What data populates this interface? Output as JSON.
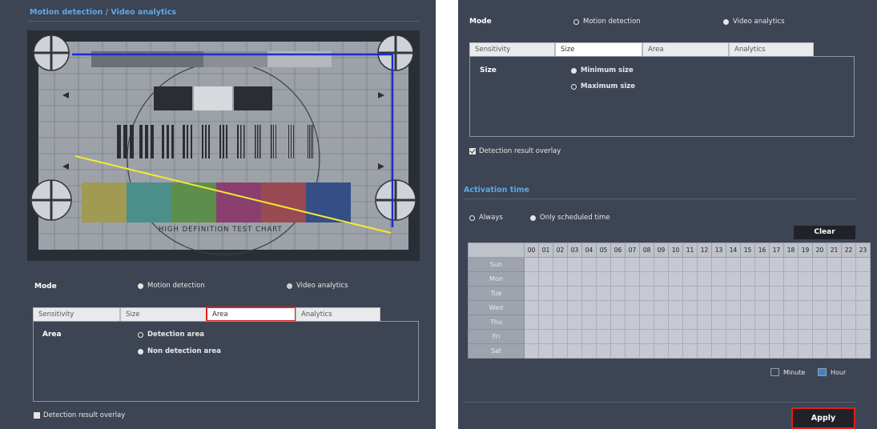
{
  "left": {
    "section_title": "Motion detection / Video analytics",
    "test_chart_text": "HIGH DEFINITION TEST CHART",
    "mode": {
      "label": "Mode",
      "options": [
        "Motion detection",
        "Video analytics"
      ],
      "selected": "Motion detection"
    },
    "tabs": [
      "Sensitivity",
      "Size",
      "Area",
      "Analytics"
    ],
    "active_tab": "Area",
    "area": {
      "label": "Area",
      "options": [
        "Detection area",
        "Non detection area"
      ],
      "selected": "Non detection area"
    },
    "overlay_label": "Detection result overlay",
    "overlay_checked": false,
    "colors": {
      "region_outline": "#1a2fd0",
      "line": "#f3ea2e",
      "highlight": "#e0201c"
    }
  },
  "right": {
    "mode": {
      "label": "Mode",
      "options": [
        "Motion detection",
        "Video analytics"
      ],
      "selected": "Video analytics"
    },
    "tabs": [
      "Sensitivity",
      "Size",
      "Area",
      "Analytics"
    ],
    "active_tab": "Size",
    "size": {
      "label": "Size",
      "options": [
        "Minimum size",
        "Maximum size"
      ],
      "selected": "Minimum size"
    },
    "overlay_label": "Detection result overlay",
    "overlay_checked": true,
    "activation": {
      "title": "Activation time",
      "options": [
        "Always",
        "Only scheduled time"
      ],
      "selected": "Only scheduled time",
      "clear_label": "Clear",
      "hours": [
        "00",
        "01",
        "02",
        "03",
        "04",
        "05",
        "06",
        "07",
        "08",
        "09",
        "10",
        "11",
        "12",
        "13",
        "14",
        "15",
        "16",
        "17",
        "18",
        "19",
        "20",
        "21",
        "22",
        "23"
      ],
      "days": [
        "Sun",
        "Mon",
        "Tue",
        "Wed",
        "Thu",
        "Fri",
        "Sat"
      ],
      "legend": [
        {
          "label": "Minute",
          "color": "#3d4453"
        },
        {
          "label": "Hour",
          "color": "#3f82c8"
        }
      ]
    },
    "apply_label": "Apply"
  }
}
